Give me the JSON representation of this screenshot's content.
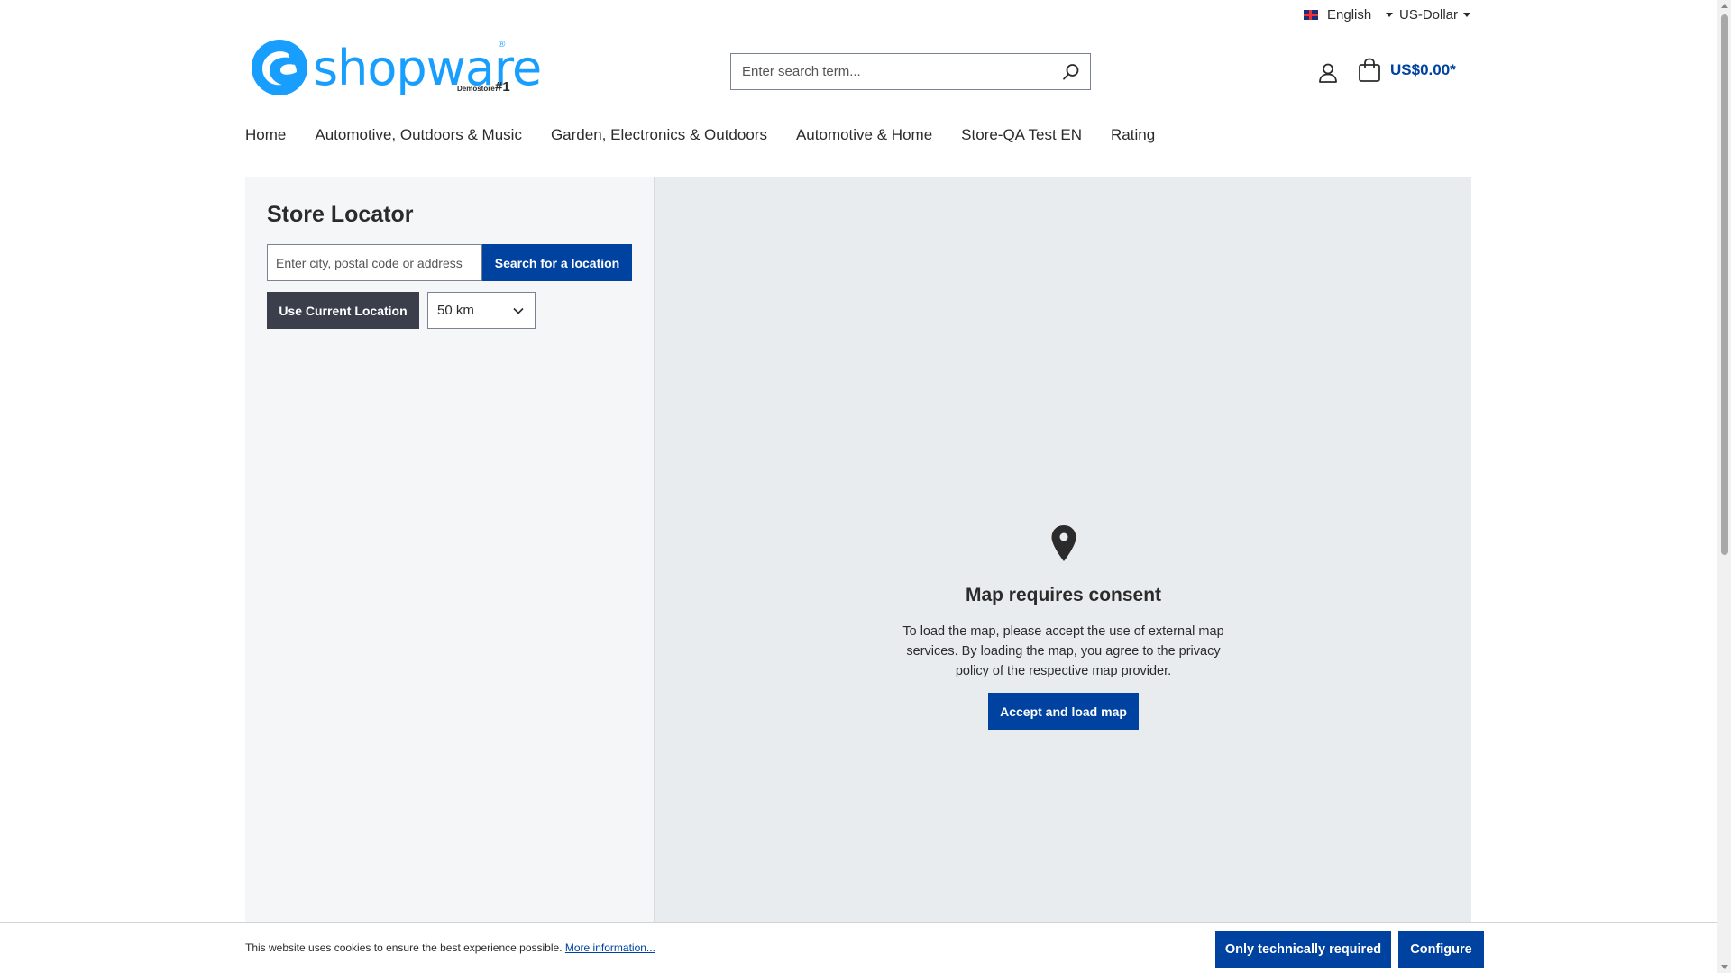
{
  "topbar": {
    "language": "English",
    "currency": "US-Dollar"
  },
  "header": {
    "logo_text": "shopware",
    "logo_sub": "Demostore",
    "logo_badge": "#1",
    "logo_reg": "®",
    "search_placeholder": "Enter search term...",
    "cart_total": "US$0.00*"
  },
  "nav": {
    "items": [
      {
        "label": "Home"
      },
      {
        "label": "Automotive, Outdoors & Music"
      },
      {
        "label": "Garden, Electronics & Outdoors"
      },
      {
        "label": "Automotive & Home"
      },
      {
        "label": "Store-QA Test EN"
      },
      {
        "label": "Rating"
      }
    ]
  },
  "store_locator": {
    "title": "Store Locator",
    "location_placeholder": "Enter city, postal code or address",
    "search_button": "Search for a location",
    "current_location_button": "Use Current Location",
    "radius_value": "50 km"
  },
  "map_consent": {
    "title": "Map requires consent",
    "text": "To load the map, please accept the use of external map services. By loading the map, you agree to the privacy policy of the respective map provider.",
    "accept_button": "Accept and load map"
  },
  "cookie_bar": {
    "text": "This website uses cookies to ensure the best experience possible.",
    "link": "More information...",
    "only_required_button": "Only technically required",
    "configure_button": "Configure"
  },
  "colors": {
    "primary": "#0042a0",
    "brand": "#189eff",
    "dark_button": "#3a3f4b",
    "map_bg": "#e9ecef"
  }
}
